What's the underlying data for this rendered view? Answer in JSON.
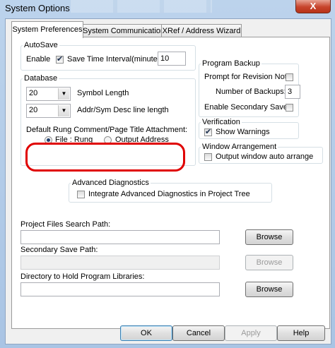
{
  "window": {
    "title": "System Options",
    "close_label": "X"
  },
  "tabs": [
    {
      "label": "System Preferences"
    },
    {
      "label": "System Communications"
    },
    {
      "label": "XRef / Address Wizard"
    }
  ],
  "autosave": {
    "title": "AutoSave",
    "enable_label": "Enable",
    "enable_checked": true,
    "interval_label": "Save Time Interval(minutes):",
    "interval_value": "10"
  },
  "database": {
    "title": "Database",
    "symbol_length_value": "20",
    "symbol_length_label": "Symbol Length",
    "desc_length_value": "20",
    "desc_length_label": "Addr/Sym Desc line length",
    "rung_title": "Default Rung Comment/Page Title Attachment:",
    "radio_file_rung": "File : Rung",
    "radio_output_address": "Output Address",
    "selected": "File : Rung"
  },
  "program_backup": {
    "title": "Program Backup",
    "prompt_label": "Prompt for Revision Note",
    "prompt_checked": false,
    "backups_label": "Number of Backups:",
    "backups_value": "3",
    "secondary_label": "Enable Secondary Save",
    "secondary_checked": false
  },
  "verification": {
    "title": "Verification",
    "warnings_label": "Show Warnings",
    "warnings_checked": true
  },
  "window_arrangement": {
    "title": "Window Arrangement",
    "auto_label": "Output window auto arrange",
    "auto_checked": false
  },
  "advanced_diagnostics": {
    "title": "Advanced Diagnostics",
    "integrate_label": "Integrate Advanced Diagnostics in Project Tree",
    "integrate_checked": false
  },
  "paths": {
    "project_label": "Project Files Search Path:",
    "project_value": "",
    "secondary_label": "Secondary Save Path:",
    "secondary_value": "",
    "libraries_label": "Directory to Hold Program Libraries:",
    "libraries_value": "",
    "browse_label": "Browse"
  },
  "buttons": {
    "ok": "OK",
    "cancel": "Cancel",
    "apply": "Apply",
    "help": "Help"
  },
  "colors": {
    "highlight": "#e00000",
    "accent": "#3c7fb1"
  }
}
